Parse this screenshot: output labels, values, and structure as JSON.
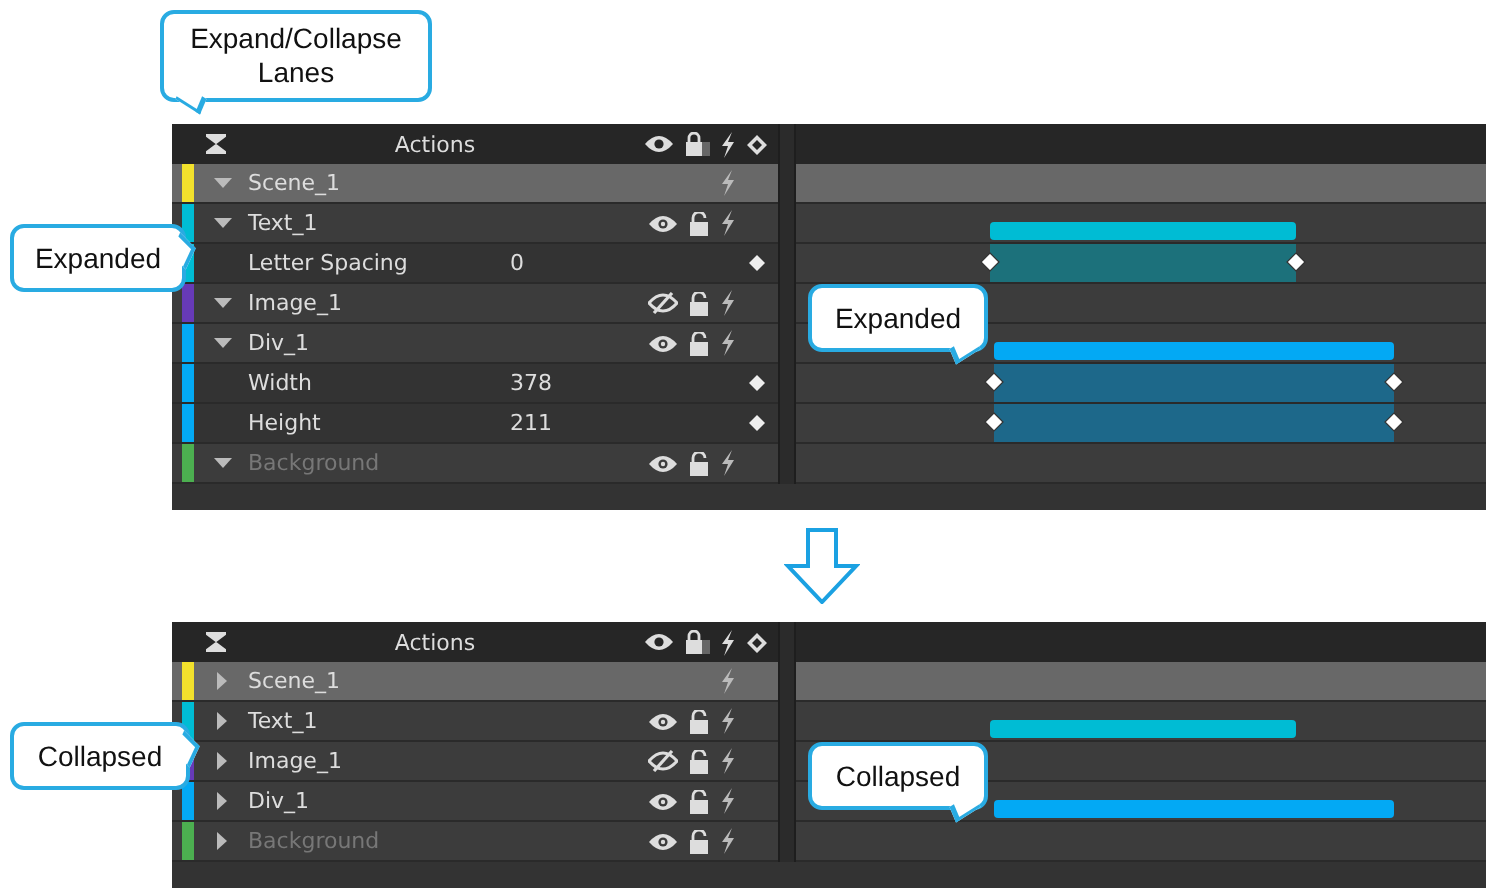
{
  "top_callout": "Expand/Collapse Lanes",
  "panels": [
    {
      "header": "Actions",
      "callouts": [
        "Expanded",
        "Expanded"
      ],
      "layers": [
        {
          "kind": "scene",
          "name": "Scene_1",
          "color": "#f2e12c",
          "expanded": true,
          "dimmed": false
        },
        {
          "kind": "element",
          "name": "Text_1",
          "color": "#00bcd4",
          "expanded": true,
          "visible": true,
          "dimmed": false,
          "properties": [
            {
              "name": "Letter Spacing",
              "value": "0"
            }
          ]
        },
        {
          "kind": "element",
          "name": "Image_1",
          "color": "#673ab7",
          "expanded": true,
          "visible": false,
          "dimmed": false
        },
        {
          "kind": "element",
          "name": "Div_1",
          "color": "#03a9f4",
          "expanded": true,
          "visible": true,
          "dimmed": false,
          "properties": [
            {
              "name": "Width",
              "value": "378"
            },
            {
              "name": "Height",
              "value": "211"
            }
          ]
        },
        {
          "kind": "element",
          "name": "Background",
          "color": "#4caf50",
          "expanded": true,
          "visible": true,
          "dimmed": true
        }
      ]
    },
    {
      "header": "Actions",
      "callouts": [
        "Collapsed",
        "Collapsed"
      ],
      "layers": [
        {
          "kind": "scene",
          "name": "Scene_1",
          "color": "#f2e12c",
          "expanded": false,
          "dimmed": false
        },
        {
          "kind": "element",
          "name": "Text_1",
          "color": "#00bcd4",
          "expanded": false,
          "visible": true,
          "dimmed": false
        },
        {
          "kind": "element",
          "name": "Image_1",
          "color": "#673ab7",
          "expanded": false,
          "visible": false,
          "dimmed": false
        },
        {
          "kind": "element",
          "name": "Div_1",
          "color": "#03a9f4",
          "expanded": false,
          "visible": true,
          "dimmed": false
        },
        {
          "kind": "element",
          "name": "Background",
          "color": "#4caf50",
          "expanded": false,
          "visible": true,
          "dimmed": true
        }
      ]
    }
  ]
}
